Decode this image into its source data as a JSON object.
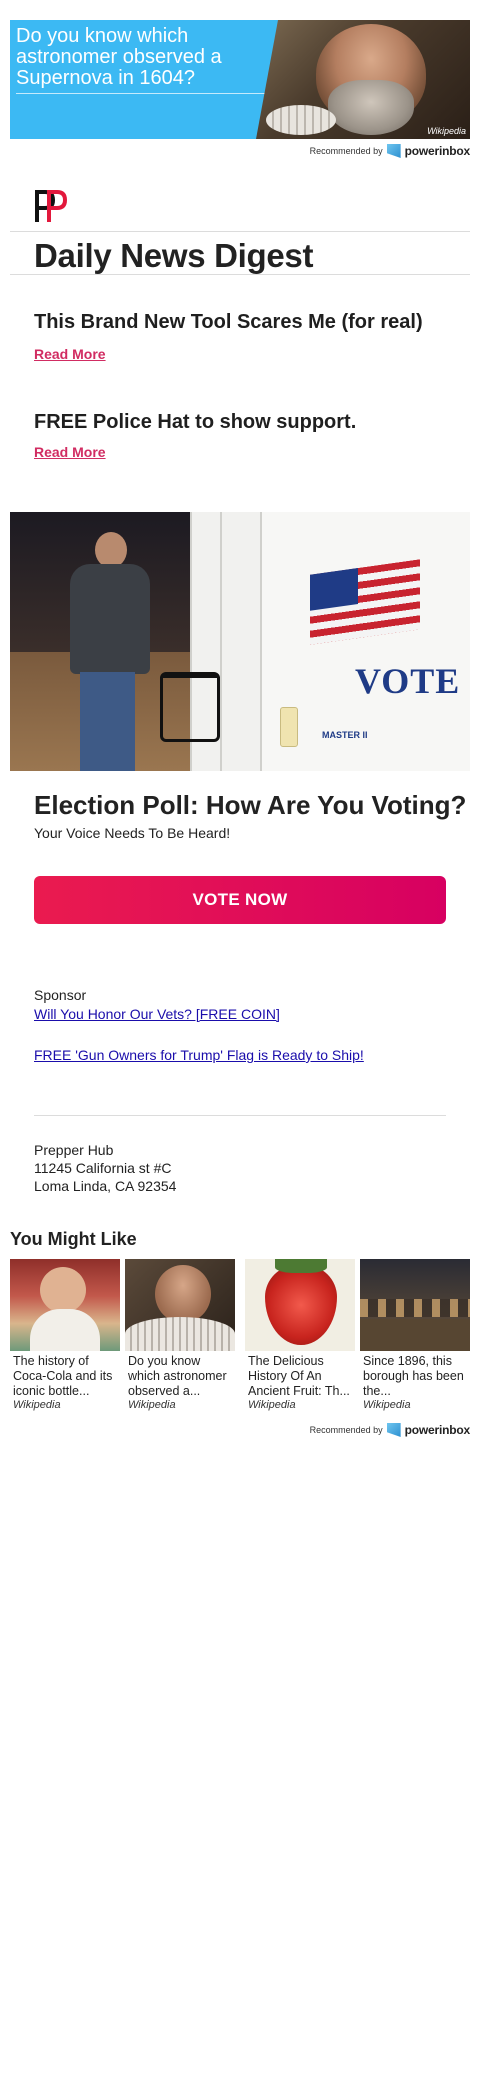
{
  "top_ad": {
    "headline": "Do you know which astronomer observed a Supernova in 1604?",
    "source": "Wikipedia"
  },
  "recommended": {
    "label": "Recommended by",
    "brand": "powerinbox"
  },
  "newsletter": {
    "title": "Daily News Digest"
  },
  "stories": [
    {
      "title": "This Brand New Tool Scares Me (for real)",
      "link_label": "Read More"
    },
    {
      "title": "FREE Police Hat to show support.",
      "link_label": "Read More"
    }
  ],
  "election_photo": {
    "vote_text": "VOTE",
    "machine_label": "MASTER II"
  },
  "poll": {
    "title": "Election Poll: How Are You Voting?",
    "subtitle": "Your Voice Needs To Be Heard!",
    "button_label": "VOTE NOW"
  },
  "sponsor": {
    "label": "Sponsor",
    "links": [
      "Will You Honor Our Vets? [FREE COIN]",
      "FREE 'Gun Owners for Trump' Flag is Ready to Ship!"
    ]
  },
  "address": {
    "name": "Prepper Hub",
    "street": "11245 California st #C",
    "city": "Loma Linda, CA 92354"
  },
  "you_might_like": {
    "title": "You Might Like",
    "cards": [
      {
        "text": "The history of Coca-Cola and its iconic bottle...",
        "source": "Wikipedia"
      },
      {
        "text": "Do you know which astronomer observed a...",
        "source": "Wikipedia"
      },
      {
        "text": "The Delicious History Of An Ancient Fruit: Th...",
        "source": "Wikipedia"
      },
      {
        "text": "Since 1896, this borough has been the...",
        "source": "Wikipedia"
      }
    ]
  },
  "colors": {
    "accent": "#d12c62",
    "button_start": "#ea1b4f",
    "button_end": "#d70061",
    "ad_blue": "#3cb9f3",
    "link_blue": "#1a0dab"
  }
}
